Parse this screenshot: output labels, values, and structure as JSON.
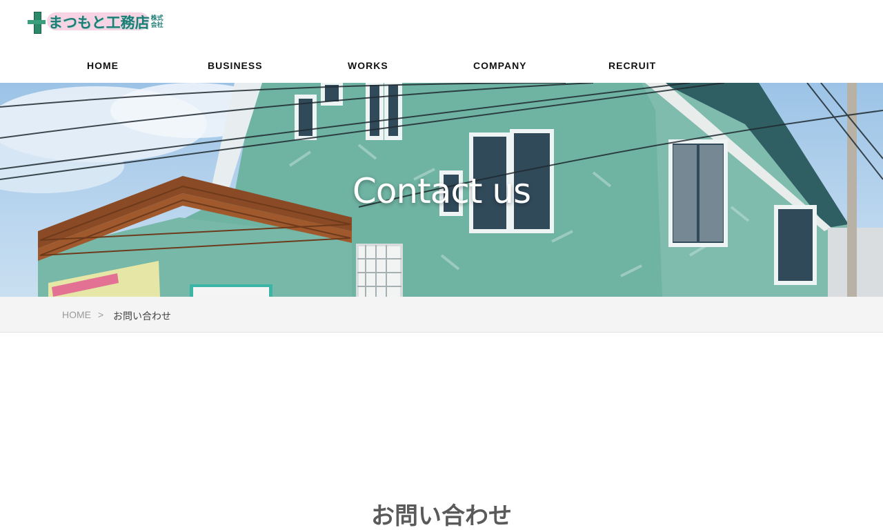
{
  "brand": {
    "name": "まつもと工務店",
    "suffix": "株式会社",
    "accent": "#1e7c76"
  },
  "nav": {
    "items": [
      {
        "label": "HOME"
      },
      {
        "label": "BUSINESS"
      },
      {
        "label": "WORKS"
      },
      {
        "label": "COMPANY"
      },
      {
        "label": "RECRUIT"
      }
    ]
  },
  "hero": {
    "title": "Contact us"
  },
  "breadcrumb": {
    "home": "HOME",
    "separator": ">",
    "current": "お問い合わせ"
  },
  "main": {
    "heading": "お問い合わせ"
  }
}
